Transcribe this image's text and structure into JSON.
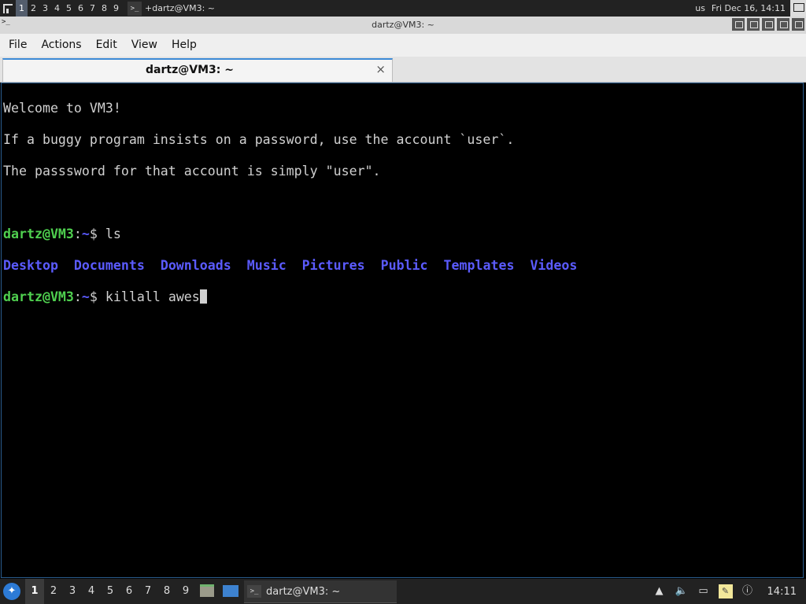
{
  "top_bar": {
    "tags": [
      "1",
      "2",
      "3",
      "4",
      "5",
      "6",
      "7",
      "8",
      "9"
    ],
    "active_tag": "1",
    "task_title": "+dartz@VM3: ~",
    "keyboard_layout": "us",
    "clock": "Fri Dec 16, 14:11",
    "icons": [
      "layout-tile-icon",
      "terminal-icon",
      "layout-floating-icon"
    ]
  },
  "window": {
    "title": "dartz@VM3: ~",
    "controls": [
      "floating-icon",
      "maximize-icon",
      "sticky-icon",
      "ontop-icon",
      "close-icon"
    ]
  },
  "menubar": {
    "items": [
      "File",
      "Actions",
      "Edit",
      "View",
      "Help"
    ]
  },
  "tabs": [
    {
      "label": "dartz@VM3: ~",
      "close": "×"
    }
  ],
  "terminal": {
    "motd": [
      "Welcome to VM3!",
      "If a buggy program insists on a password, use the account `user`.",
      "The passsword for that account is simply \"user\"."
    ],
    "prompt": {
      "user": "dartz@VM3",
      "sep": ":",
      "path": "~",
      "symbol": "$ "
    },
    "cmd1": "ls",
    "ls_output": [
      "Desktop",
      "Documents",
      "Downloads",
      "Music",
      "Pictures",
      "Public",
      "Templates",
      "Videos"
    ],
    "cmd2": "killall awes",
    "colors": {
      "prompt_user": "#4fd04f",
      "directory": "#5b5bff",
      "text": "#d0d0d0"
    }
  },
  "bottom_bar": {
    "tags": [
      "1",
      "2",
      "3",
      "4",
      "5",
      "6",
      "7",
      "8",
      "9"
    ],
    "active_tag": "1",
    "task_title": "dartz@VM3: ~",
    "clock": "14:11",
    "tray_icons": [
      "scroll-up-icon",
      "volume-icon",
      "network-icon",
      "notes-icon",
      "update-notifier-icon"
    ]
  }
}
